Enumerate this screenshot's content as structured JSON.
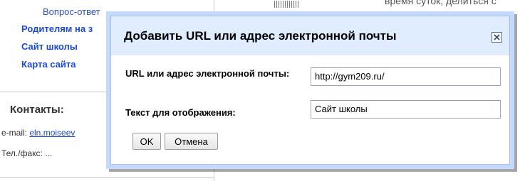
{
  "background": {
    "sidebar": {
      "items": [
        {
          "label": "Вопрос-ответ"
        },
        {
          "label": "Родителям на з"
        },
        {
          "label": "Сайт школы"
        },
        {
          "label": "Карта сайта"
        }
      ],
      "contacts_title": "Контакты:",
      "email_label": "e-mail: ",
      "email_link": "eln.moiseev",
      "phone_label": "Тел./факс: ..."
    },
    "top_text": "время суток, делиться с"
  },
  "dialog": {
    "title": "Добавить URL или адрес электронной почты",
    "url_label": "URL или адрес электронной почты:",
    "url_value": "http://gym209.ru/",
    "display_text_label": "Текст для отображения:",
    "display_text_value": "Сайт школы",
    "ok_label": "OK",
    "cancel_label": "Отмена",
    "close_icon": "close-icon"
  },
  "colors": {
    "dialog_border": "#c3d9ff",
    "dialog_header": "#e0ecff",
    "link": "#1a4bd6"
  }
}
